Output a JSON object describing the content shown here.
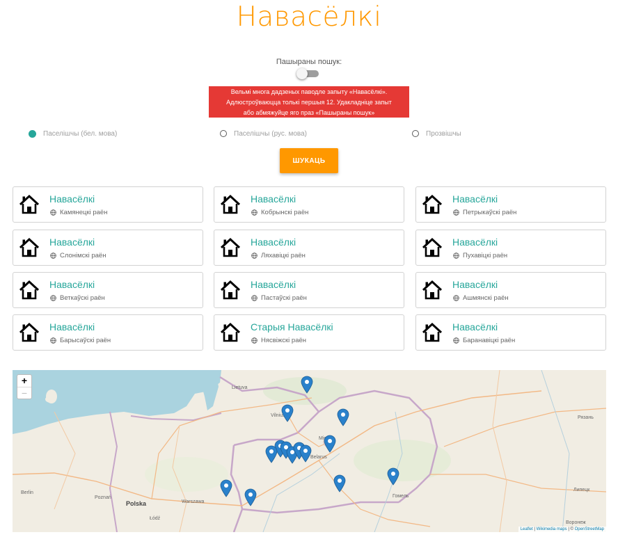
{
  "header": {
    "title": "Навасёлкі",
    "title_color": "#ff9800"
  },
  "advanced": {
    "label": "Пашыраны пошук:",
    "enabled": false
  },
  "alert": {
    "lines": [
      "Вельмі многа дадзеных паводле запыту «Навасёлкі».",
      "Адлюстроўваюцца толькі першыя 12. Удакладніце запыт",
      "або абмяжуйце яго праз «Пашыраны пошук»"
    ],
    "color": "#e53935"
  },
  "search_type": {
    "options": [
      "Паселішчы (бел. мова)",
      "Паселішчы (рус. мова)",
      "Прозвішчы"
    ],
    "selected_index": 0
  },
  "search_button": {
    "label": "ШУКАЦЬ",
    "color": "#ff9800"
  },
  "results": [
    {
      "name": "Навасёлкі",
      "district": "Камянецкі раён"
    },
    {
      "name": "Навасёлкі",
      "district": "Кобрынскі раён"
    },
    {
      "name": "Навасёлкі",
      "district": "Петрыкаўскі раён"
    },
    {
      "name": "Навасёлкі",
      "district": "Слонімскі раён"
    },
    {
      "name": "Навасёлкі",
      "district": "Ляхавіцкі раён"
    },
    {
      "name": "Навасёлкі",
      "district": "Пухавіцкі раён"
    },
    {
      "name": "Навасёлкі",
      "district": "Веткаўскі раён"
    },
    {
      "name": "Навасёлкі",
      "district": "Пастаўскі раён"
    },
    {
      "name": "Навасёлкі",
      "district": "Ашмянскі раён"
    },
    {
      "name": "Навасёлкі",
      "district": "Барысаўскі раён"
    },
    {
      "name": "Старыя Навасёлкі",
      "district": "Нясвіжскі раён"
    },
    {
      "name": "Навасёлкі",
      "district": "Баранавіцкі раён"
    }
  ],
  "result_accent_color": "#26a69a",
  "map": {
    "zoom_in": "+",
    "zoom_out": "−",
    "labels": {
      "lietuva": "Lietuva",
      "vilnius": "Vilnius",
      "minsk": "Minsk",
      "belarus": "Belarus",
      "polska": "Polska",
      "warszawa": "Warszawa",
      "poznan": "Poznań",
      "lodz": "Łódź",
      "berlin": "Berlin",
      "gomel": "Гомель",
      "ryazan": "Рязань",
      "lipetsk": "Липецк",
      "voronezh": "Воронеж"
    },
    "attribution": {
      "leaflet": "Leaflet",
      "sep1": " | ",
      "wikimedia": "Wikimedia maps",
      "sep2": " | © ",
      "osm": "OpenStreetMap"
    },
    "marker_color": "#2a81cb"
  }
}
